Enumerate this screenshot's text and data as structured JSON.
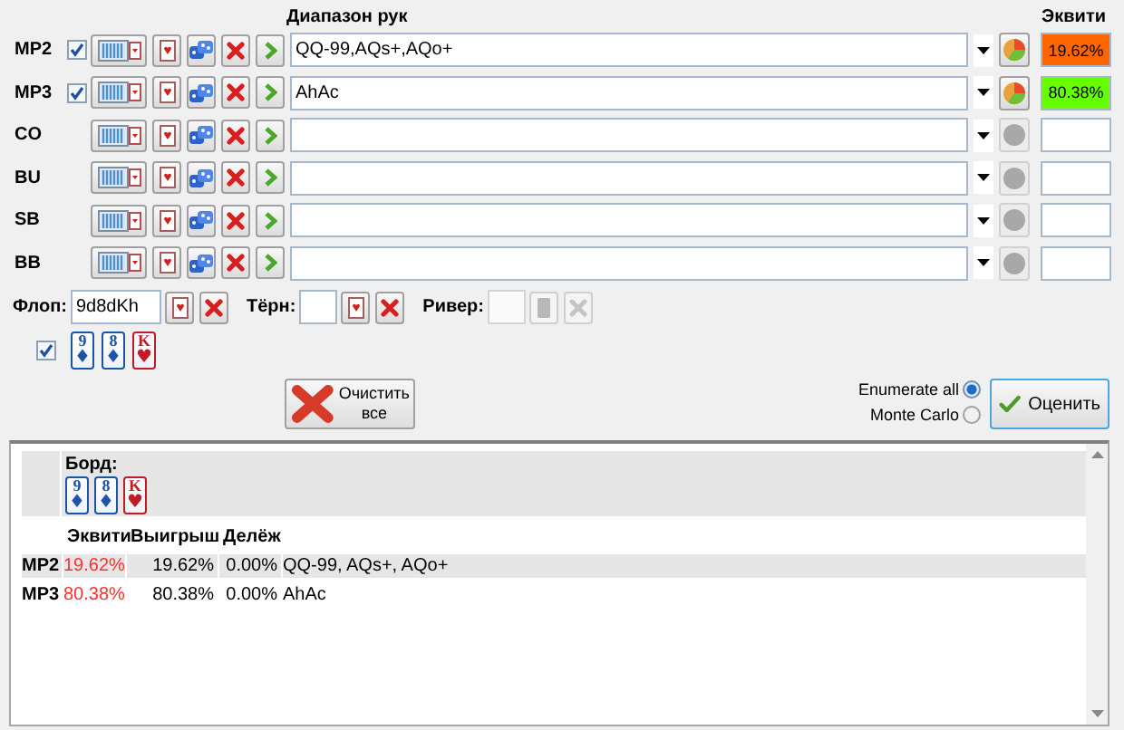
{
  "headers": {
    "range": "Диапазон рук",
    "equity": "Эквити"
  },
  "players": [
    {
      "name": "MP2",
      "checked": true,
      "range": "QQ-99,AQs+,AQo+",
      "equity": "19.62%",
      "color": "#ff6600"
    },
    {
      "name": "MP3",
      "checked": true,
      "range": "AhAc",
      "equity": "80.38%",
      "color": "#66ff00"
    },
    {
      "name": "CO"
    },
    {
      "name": "BU"
    },
    {
      "name": "SB"
    },
    {
      "name": "BB"
    }
  ],
  "board": {
    "flop_label": "Флоп:",
    "flop": "9d8dKh",
    "turn_label": "Тёрн:",
    "river_label": "Ривер:",
    "river_disabled": true,
    "show_cards": true,
    "cards": [
      {
        "rank": "9",
        "suit": "♦",
        "color": "#1c55a8"
      },
      {
        "rank": "8",
        "suit": "♦",
        "color": "#1c55a8"
      },
      {
        "rank": "K",
        "suit": "♥",
        "color": "#c01c28"
      }
    ]
  },
  "clear_button": "Очистить все",
  "methods": [
    {
      "label": "Enumerate all",
      "selected": true
    },
    {
      "label": "Monte Carlo",
      "selected": false
    }
  ],
  "evaluate_button": "Оценить",
  "results": {
    "board_label": "Борд:",
    "board_cards": [
      {
        "rank": "9",
        "suit": "♦",
        "color": "#1c55a8"
      },
      {
        "rank": "8",
        "suit": "♦",
        "color": "#1c55a8"
      },
      {
        "rank": "K",
        "suit": "♥",
        "color": "#c01c28"
      }
    ],
    "columns": [
      "Эквити",
      "Выигрыш",
      "Делёж"
    ],
    "rows": [
      {
        "player": "MP2",
        "equity": "19.62%",
        "win": "19.62%",
        "tie": "0.00%",
        "range": "QQ-99, AQs+, AQo+"
      },
      {
        "player": "MP3",
        "equity": "80.38%",
        "win": "80.38%",
        "tie": "0.00%",
        "range": "AhAc"
      }
    ]
  }
}
